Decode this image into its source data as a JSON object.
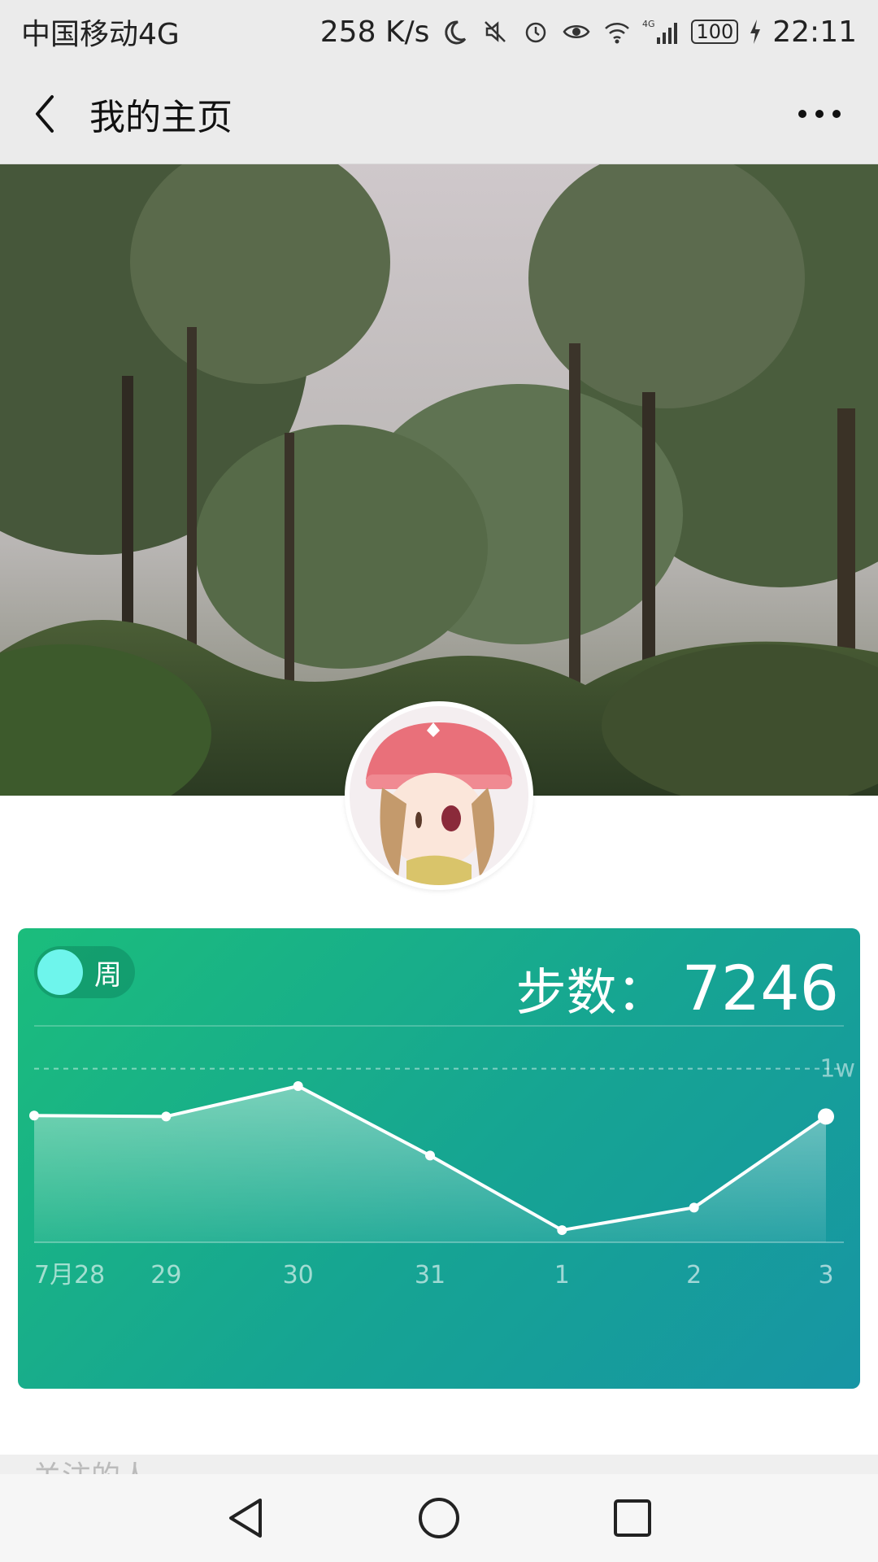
{
  "status_bar": {
    "carrier": "中国移动4G",
    "speed": "258 K/s",
    "network_badge": "4G",
    "battery": "100",
    "time": "22:11"
  },
  "header": {
    "title": "我的主页",
    "back_icon": "chevron-left-icon",
    "more_icon": "more-dots-icon"
  },
  "steps_card": {
    "toggle_label": "周",
    "steps_label": "步数：",
    "steps_value": "7246",
    "reference_label": "1w",
    "colors": {
      "gradient_start": "#1bbd7c",
      "gradient_end": "#1795a4",
      "toggle_knob": "#6ef5ec"
    }
  },
  "chart_data": {
    "type": "area",
    "categories": [
      "7月28",
      "29",
      "30",
      "31",
      "1",
      "2",
      "3"
    ],
    "values": [
      7300,
      7250,
      9000,
      5000,
      700,
      2000,
      7246
    ],
    "ylim": [
      0,
      12000
    ],
    "reference_line": 10000,
    "highlight_index": 6,
    "grid": false
  },
  "bottom_section": {
    "peek_text": "关注的人"
  },
  "nav_bar": {
    "back_icon": "triangle-back-icon",
    "home_icon": "circle-home-icon",
    "recents_icon": "square-recents-icon"
  }
}
